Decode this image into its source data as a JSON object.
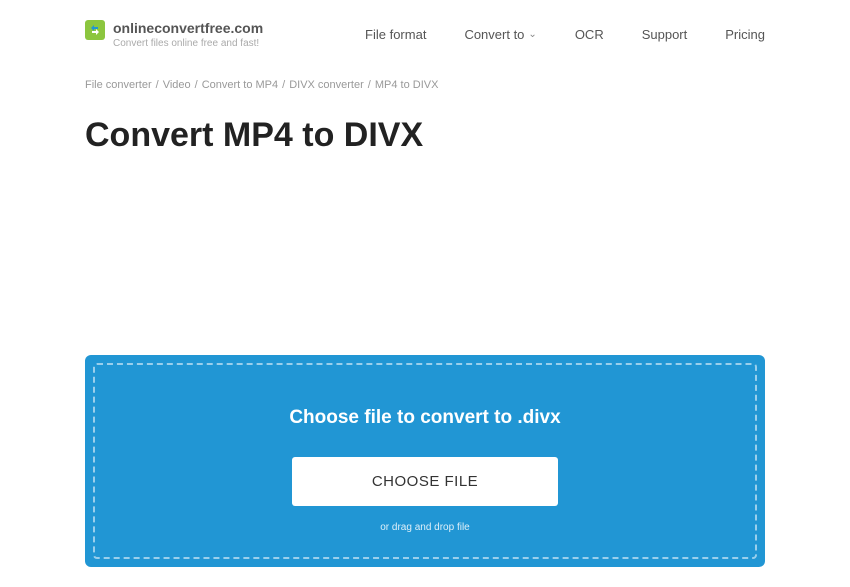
{
  "header": {
    "site_name": "onlineconvertfree.com",
    "tagline": "Convert files online free and fast!"
  },
  "nav": {
    "file_format": "File format",
    "convert_to": "Convert to",
    "ocr": "OCR",
    "support": "Support",
    "pricing": "Pricing"
  },
  "breadcrumb": {
    "items": [
      "File converter",
      "Video",
      "Convert to MP4",
      "DIVX converter",
      "MP4 to DIVX"
    ]
  },
  "page_title": "Convert MP4 to DIVX",
  "upload": {
    "title": "Choose file to convert to .divx",
    "button": "CHOOSE FILE",
    "hint": "or drag and drop file"
  }
}
